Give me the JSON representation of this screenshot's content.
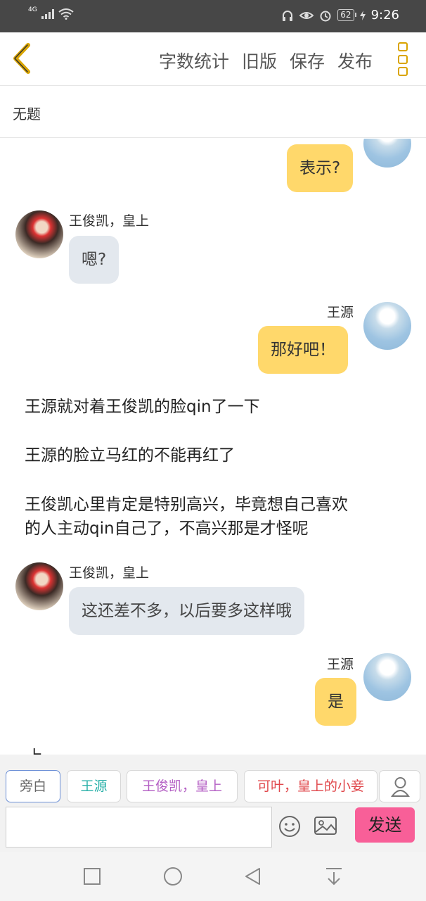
{
  "status": {
    "network": "4G",
    "battery": "62",
    "time": "9:26"
  },
  "toolbar": {
    "word_count": "字数统计",
    "old_version": "旧版",
    "save": "保存",
    "publish": "发布"
  },
  "doc": {
    "title": "无题"
  },
  "chat": {
    "m1_text": "表示?",
    "m2_name": "王俊凯，皇上",
    "m2_text": "嗯?",
    "m3_name": "王源",
    "m3_text": "那好吧！",
    "n1": "王源就对着王俊凯的脸qin了一下",
    "n2": "王源的脸立马红的不能再红了",
    "n3a": "王俊凯心里肯定是特别高兴，毕竟想自己喜欢",
    "n3b": "的人主动qin自己了，不高兴那是才怪呢",
    "m4_name": "王俊凯，皇上",
    "m4_text": "这还差不多，以后要多这样哦",
    "m5_name": "王源",
    "m5_text": "是",
    "cut": "上"
  },
  "characters": [
    {
      "label": "旁白",
      "color": "#666666"
    },
    {
      "label": "王源",
      "color": "#2ab0a8"
    },
    {
      "label": "王俊凯，皇上",
      "color": "#b45fc4"
    },
    {
      "label": "可叶，皇上的小妾",
      "color": "#e0484c"
    }
  ],
  "composer": {
    "send_label": "发送",
    "placeholder": ""
  },
  "colors": {
    "accent": "#d9a400",
    "my_bubble": "#ffd86b",
    "other_bubble": "#e3e8ee",
    "send": "#f85f98"
  }
}
